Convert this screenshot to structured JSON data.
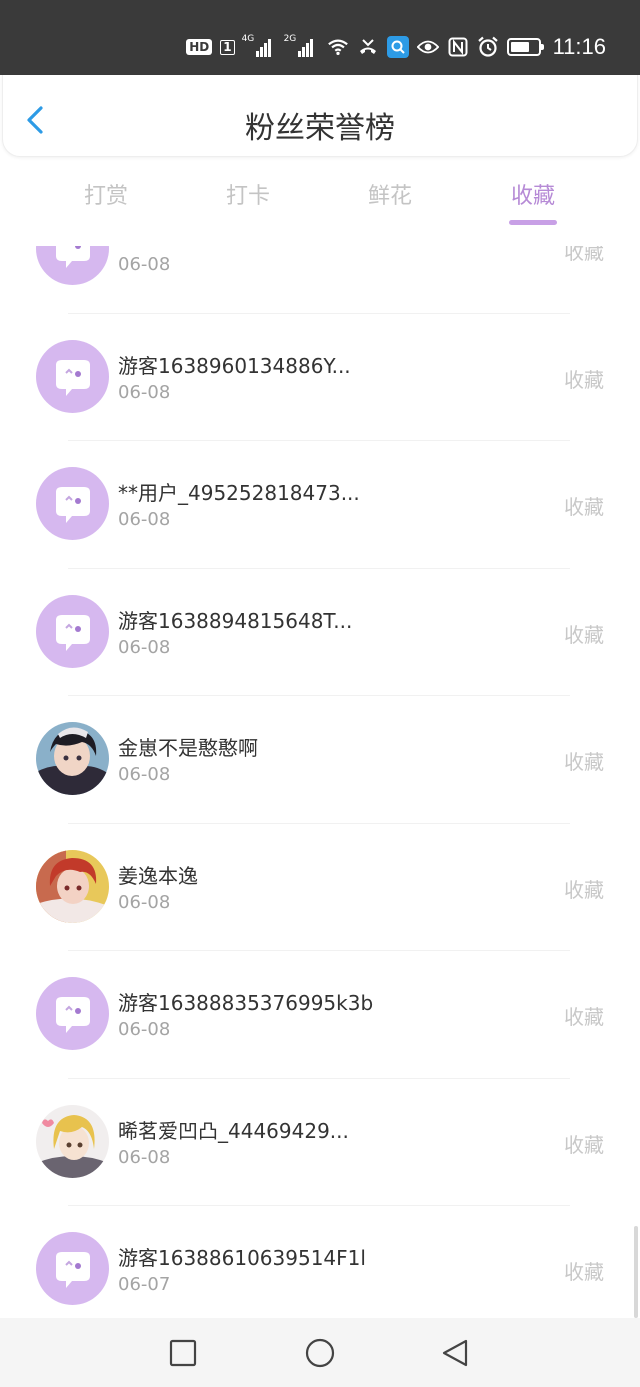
{
  "status_bar": {
    "hd": "HD",
    "sim": "1",
    "net1": "4G",
    "net2": "2G",
    "time": "11:16"
  },
  "header": {
    "title": "粉丝荣誉榜"
  },
  "tabs": [
    {
      "label": "打赏"
    },
    {
      "label": "打卡"
    },
    {
      "label": "鲜花"
    },
    {
      "label": "收藏"
    }
  ],
  "list": [
    {
      "name": "",
      "date": "06-08",
      "action": "收藏"
    },
    {
      "name": "游客1638960134886Y...",
      "date": "06-08",
      "action": "收藏"
    },
    {
      "name": "**用户_495252818473...",
      "date": "06-08",
      "action": "收藏"
    },
    {
      "name": "游客1638894815648T...",
      "date": "06-08",
      "action": "收藏"
    },
    {
      "name": "金崽不是憨憨啊",
      "date": "06-08",
      "action": "收藏"
    },
    {
      "name": "姜逸本逸",
      "date": "06-08",
      "action": "收藏"
    },
    {
      "name": "游客16388835376995k3b",
      "date": "06-08",
      "action": "收藏"
    },
    {
      "name": "晞茗爱凹凸_44469429...",
      "date": "06-08",
      "action": "收藏"
    },
    {
      "name": "游客16388610639514F1l",
      "date": "06-07",
      "action": "收藏"
    }
  ],
  "colors": {
    "accent": "#b68ad6",
    "default_avatar": "#d6b8ef"
  }
}
